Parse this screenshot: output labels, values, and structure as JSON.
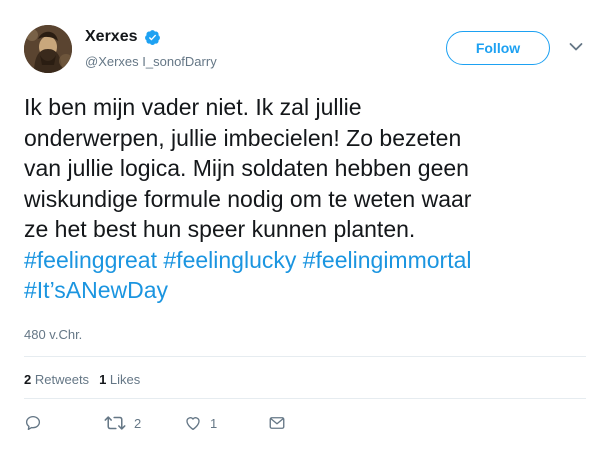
{
  "tweet": {
    "display_name": "Xerxes",
    "verified_icon": "verified-badge-icon",
    "handle": "@Xerxes I_sonofDarry",
    "follow_label": "Follow",
    "text_lines": [
      [
        {
          "t": "Ik ben mijn vader niet. Ik zal jullie"
        }
      ],
      [
        {
          "t": "onderwerpen, jullie imbecielen! Zo bezeten"
        }
      ],
      [
        {
          "t": "van jullie logica. Mijn soldaten hebben geen"
        }
      ],
      [
        {
          "t": "wiskundige formule nodig om te weten waar"
        }
      ],
      [
        {
          "t": "ze het best hun speer kunnen planten."
        }
      ],
      [
        {
          "t": "#feelinggreat",
          "tag": true
        },
        {
          "t": " "
        },
        {
          "t": "#feelinglucky",
          "tag": true
        },
        {
          "t": " "
        },
        {
          "t": "#feelingimmortal",
          "tag": true
        }
      ],
      [
        {
          "t": "#It’sANewDay",
          "tag": true
        }
      ]
    ],
    "timestamp": "480 v.Chr.",
    "stats": {
      "retweets_count": "2",
      "retweets_label": "Retweets",
      "likes_count": "1",
      "likes_label": "Likes"
    },
    "actions": {
      "reply_icon": "reply-icon",
      "retweet_icon": "retweet-icon",
      "retweet_count": "2",
      "like_icon": "heart-icon",
      "like_count": "1",
      "dm_icon": "envelope-icon"
    }
  },
  "colors": {
    "accent": "#1da1f2",
    "hashtag": "#1b95e0",
    "text": "#14171a",
    "secondary": "#657786",
    "divider": "#e6ecf0"
  }
}
